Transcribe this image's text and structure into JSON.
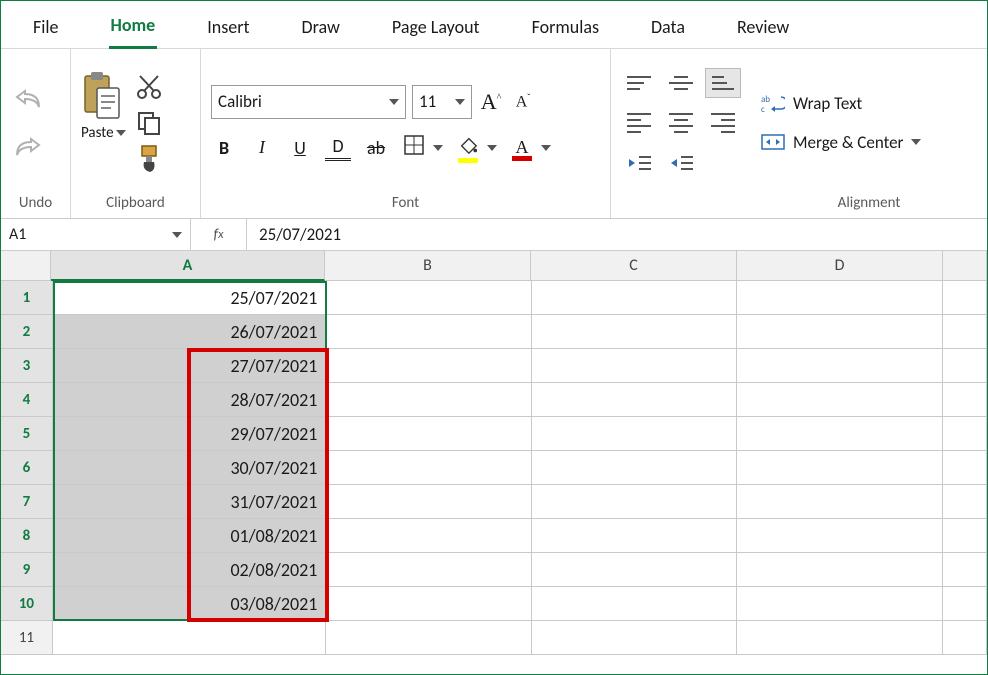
{
  "tabs": [
    "File",
    "Home",
    "Insert",
    "Draw",
    "Page Layout",
    "Formulas",
    "Data",
    "Review"
  ],
  "active_tab": "Home",
  "ribbon_groups": {
    "undo": "Undo",
    "clipboard": {
      "label": "Clipboard",
      "paste": "Paste"
    },
    "font": {
      "label": "Font",
      "name": "Calibri",
      "size": "11",
      "btns": {
        "B": "B",
        "I": "I",
        "U": "U"
      }
    },
    "alignment": {
      "label": "Alignment",
      "wrap": "Wrap Text",
      "merge": "Merge & Center"
    }
  },
  "name_box": "A1",
  "formula_value": "25/07/2021",
  "columns": [
    "A",
    "B",
    "C",
    "D",
    ""
  ],
  "rows": [
    {
      "n": 1,
      "A": "25/07/2021"
    },
    {
      "n": 2,
      "A": "26/07/2021"
    },
    {
      "n": 3,
      "A": "27/07/2021"
    },
    {
      "n": 4,
      "A": "28/07/2021"
    },
    {
      "n": 5,
      "A": "29/07/2021"
    },
    {
      "n": 6,
      "A": "30/07/2021"
    },
    {
      "n": 7,
      "A": "31/07/2021"
    },
    {
      "n": 8,
      "A": "01/08/2021"
    },
    {
      "n": 9,
      "A": "02/08/2021"
    },
    {
      "n": 10,
      "A": "03/08/2021"
    },
    {
      "n": 11,
      "A": ""
    }
  ],
  "selection": {
    "col": "A",
    "rows": [
      1,
      10
    ]
  },
  "red_box_rows": [
    3,
    10
  ]
}
